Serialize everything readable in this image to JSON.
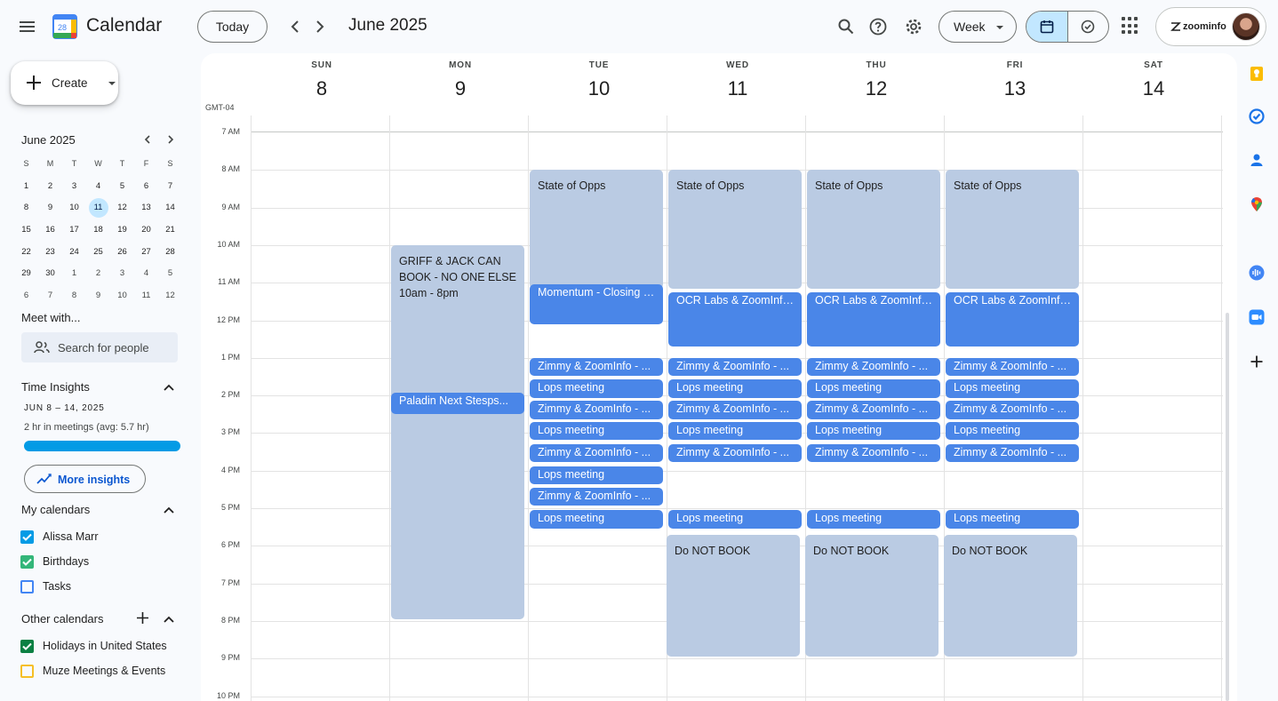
{
  "app": {
    "title": "Calendar",
    "logo_day": "28"
  },
  "header": {
    "today_label": "Today",
    "month_title": "June 2025",
    "view_label": "Week",
    "brand": "zoominfo"
  },
  "sidebar": {
    "create_label": "Create",
    "mini_calendar": {
      "title": "June 2025",
      "weekday_headers": [
        "S",
        "M",
        "T",
        "W",
        "T",
        "F",
        "S"
      ],
      "weeks": [
        [
          "1",
          "2",
          "3",
          "4",
          "5",
          "6",
          "7"
        ],
        [
          "8",
          "9",
          "10",
          "11",
          "12",
          "13",
          "14"
        ],
        [
          "15",
          "16",
          "17",
          "18",
          "19",
          "20",
          "21"
        ],
        [
          "22",
          "23",
          "24",
          "25",
          "26",
          "27",
          "28"
        ],
        [
          "29",
          "30",
          "1",
          "2",
          "3",
          "4",
          "5"
        ],
        [
          "6",
          "7",
          "8",
          "9",
          "10",
          "11",
          "12"
        ]
      ],
      "selected": "11"
    },
    "meet_with_label": "Meet with...",
    "search_people_placeholder": "Search for people",
    "time_insights": {
      "label": "Time Insights",
      "range": "JUN 8 – 14, 2025",
      "summary": "2 hr in meetings (avg: 5.7 hr)",
      "button_label": "More insights"
    },
    "my_calendars_label": "My calendars",
    "my_calendars": [
      {
        "name": "Alissa Marr",
        "checked": true,
        "color": "#039be5"
      },
      {
        "name": "Birthdays",
        "checked": true,
        "color": "#33b679"
      },
      {
        "name": "Tasks",
        "checked": false,
        "color": "#4285f4"
      }
    ],
    "other_calendars_label": "Other calendars",
    "other_calendars": [
      {
        "name": "Holidays in United States",
        "checked": true,
        "color": "#0b8043"
      },
      {
        "name": "Muze Meetings & Events",
        "checked": false,
        "color": "#f6bf26"
      }
    ]
  },
  "week": {
    "timezone": "GMT-04",
    "days": [
      {
        "dow": "SUN",
        "num": "8"
      },
      {
        "dow": "MON",
        "num": "9"
      },
      {
        "dow": "TUE",
        "num": "10"
      },
      {
        "dow": "WED",
        "num": "11"
      },
      {
        "dow": "THU",
        "num": "12"
      },
      {
        "dow": "FRI",
        "num": "13"
      },
      {
        "dow": "SAT",
        "num": "14"
      }
    ],
    "hours": [
      "7 AM",
      "8 AM",
      "9 AM",
      "10 AM",
      "11 AM",
      "12 PM",
      "1 PM",
      "2 PM",
      "3 PM",
      "4 PM",
      "5 PM",
      "6 PM",
      "7 PM",
      "8 PM",
      "9 PM",
      "10 PM"
    ]
  },
  "events": {
    "griff": "GRIFF & JACK CAN BOOK - NO ONE ELSE 10am - 8pm",
    "paladin": "Paladin Next Stesps...",
    "state_of_opps": "State of Opps",
    "momentum": "Momentum - Closing meeting",
    "ocr": "OCR Labs & ZoomInfo - Next Steps",
    "zimmy": "Zimmy & ZoomInfo - ...",
    "lops": "Lops meeting",
    "do_not_book": "Do NOT BOOK"
  },
  "colors": {
    "accent": "#0b57d0",
    "event_dark": "#4a86e8",
    "event_light": "#bacbe3",
    "selected_bg": "#c2e7ff"
  }
}
